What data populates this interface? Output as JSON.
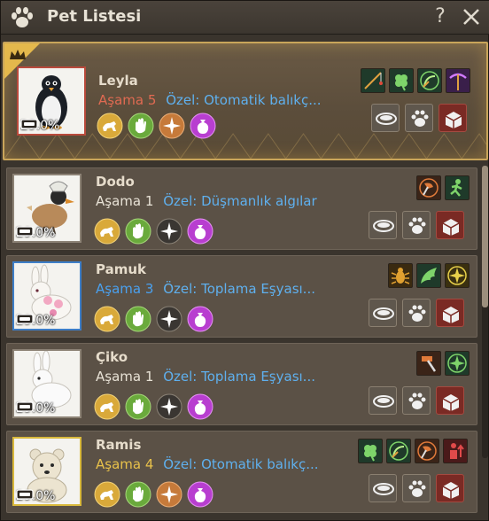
{
  "window": {
    "title": "Pet Listesi",
    "help_label": "?"
  },
  "pets": [
    {
      "name": "Leyla",
      "stage_word": "Aşama",
      "stage": "5",
      "stage_color": "#e06a52",
      "special": "Özel: Otomatik balıkç...",
      "feed": "29.0%",
      "frame": "#b94a3c",
      "animal": "penguin",
      "passives": [
        "fishing-rod-icon",
        "clover-icon",
        "sickle-icon",
        "pickaxe-icon"
      ]
    },
    {
      "name": "Dodo",
      "stage_word": "Aşama",
      "stage": "1",
      "stage_color": "#e8e2d6",
      "special": "Özel: Düşmanlık algılar",
      "feed": "29.0%",
      "frame": "#8c8275",
      "animal": "dodo",
      "passives": [
        "axe-icon",
        "running-man-icon"
      ]
    },
    {
      "name": "Pamuk",
      "stage_word": "Aşama",
      "stage": "3",
      "stage_color": "#4aa0ee",
      "special": "Özel: Toplama Eşyası...",
      "feed": "29.0%",
      "frame": "#3d7ec8",
      "animal": "rabbit-flower",
      "passives": [
        "bug-icon",
        "wing-icon",
        "compass-icon"
      ]
    },
    {
      "name": "Çiko",
      "stage_word": "Aşama",
      "stage": "1",
      "stage_color": "#e8e2d6",
      "special": "Özel: Toplama Eşyası...",
      "feed": "29.0%",
      "frame": "#8c8275",
      "animal": "rabbit",
      "passives": [
        "hammer-icon",
        "compass-icon"
      ]
    },
    {
      "name": "Ramis",
      "stage_word": "Aşama",
      "stage": "4",
      "stage_color": "#e8c14a",
      "special": "Özel: Otomatik balıkç...",
      "feed": "29.0%",
      "frame": "#d9b93c",
      "animal": "bear",
      "passives": [
        "clover-icon",
        "sickle-icon",
        "axe-icon",
        "person-up-icon"
      ]
    }
  ]
}
